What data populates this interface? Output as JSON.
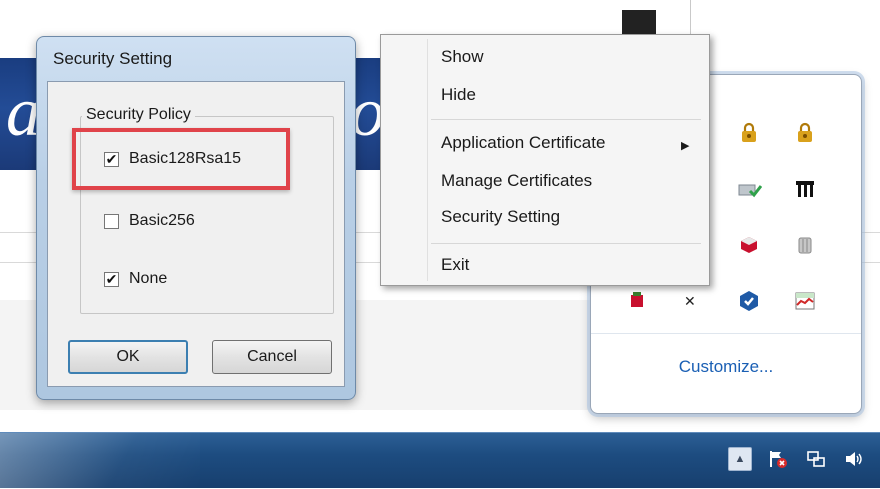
{
  "dialog": {
    "title": "Security Setting",
    "group_label": "Security Policy",
    "options": [
      {
        "label": "Basic128Rsa15",
        "checked": true
      },
      {
        "label": "Basic256",
        "checked": false
      },
      {
        "label": "None",
        "checked": true
      }
    ],
    "ok_label": "OK",
    "cancel_label": "Cancel",
    "check_mark": "✔"
  },
  "context_menu": {
    "items": [
      {
        "label": "Show"
      },
      {
        "label": "Hide"
      },
      {
        "label": "Application Certificate",
        "has_submenu": true
      },
      {
        "label": "Manage Certificates"
      },
      {
        "label": "Security Setting"
      },
      {
        "label": "Exit"
      }
    ],
    "submenu_arrow": "▶"
  },
  "tray_panel": {
    "customize_label": "Customize...",
    "icons": [
      "lock-icon",
      "lock-icon",
      "network-icon",
      "printer-icon",
      "device-icon",
      "jar-icon",
      "shield-icon",
      "chart-icon",
      "flag-icon",
      "media-icon"
    ]
  },
  "taskbar": {
    "tray_icons": [
      "show-hidden-icons",
      "action-center-icon",
      "network-icon",
      "volume-icon"
    ]
  },
  "colors": {
    "highlight": "#e0434a",
    "banner": "#234c96",
    "taskbar": "#1d4c80",
    "link": "#1a5fb4"
  }
}
